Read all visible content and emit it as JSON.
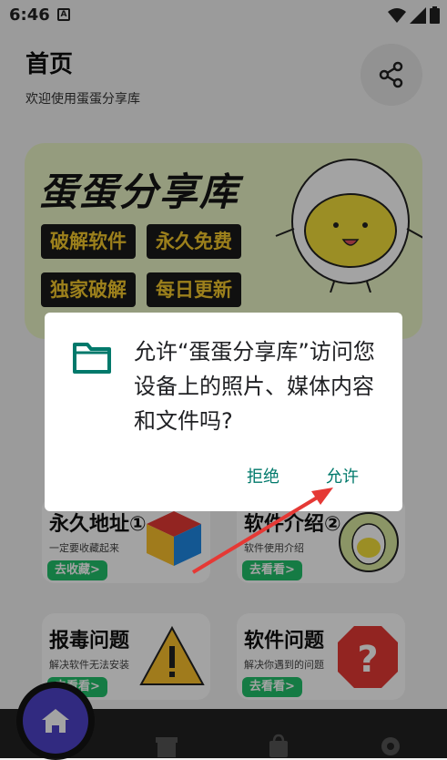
{
  "status_bar": {
    "time": "6:46",
    "notif_letter": "A"
  },
  "header": {
    "title": "首页",
    "subtitle": "欢迎使用蛋蛋分享库"
  },
  "banner": {
    "title": "蛋蛋分享库",
    "tags": [
      "破解软件",
      "永久免费",
      "独家破解",
      "每日更新"
    ]
  },
  "cards": [
    {
      "title": "永久地址①",
      "subtitle": "一定要收藏起来",
      "button": "去收藏>"
    },
    {
      "title": "软件介绍②",
      "subtitle": "软件使用介绍",
      "button": "去看看>"
    },
    {
      "title": "报毒问题",
      "subtitle": "解决软件无法安装",
      "button": "去看看>"
    },
    {
      "title": "软件问题",
      "subtitle": "解决你遇到的问题",
      "button": "去看看>"
    }
  ],
  "dialog": {
    "message": "允许“蛋蛋分享库”访问您设备上的照片、媒体内容和文件吗?",
    "deny": "拒绝",
    "allow": "允许"
  },
  "colors": {
    "accent": "#00796b",
    "nav_home": "#4d43c9",
    "green_btn": "#22c16b",
    "tag_text": "#f4c82c"
  },
  "icons": [
    "share-icon",
    "folder-icon",
    "home-icon",
    "wifi-icon",
    "signal-icon",
    "battery-icon",
    "cube-icon",
    "warning-icon",
    "stop-sign-icon"
  ]
}
